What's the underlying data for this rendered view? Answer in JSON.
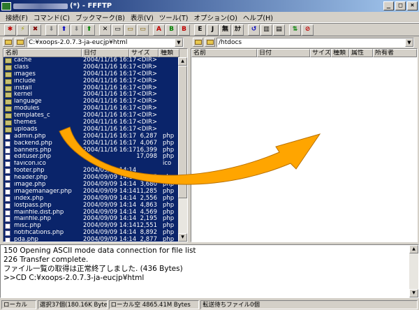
{
  "window": {
    "title": "(*) - FFFTP"
  },
  "menu": [
    "接続(F)",
    "コマンド(C)",
    "ブックマーク(B)",
    "表示(V)",
    "ツール(T)",
    "オプション(O)",
    "ヘルプ(H)"
  ],
  "toolbar": {
    "buttons": [
      {
        "name": "connect-button",
        "glyph": "✱",
        "color": "#c00000"
      },
      {
        "name": "quick-connect-button",
        "glyph": "⚡",
        "color": "#a0a000"
      },
      {
        "name": "disconnect-button",
        "glyph": "✖",
        "color": "#800000"
      },
      {
        "name": "download-button",
        "glyph": "⬇",
        "color": "#808080"
      },
      {
        "name": "upload-button",
        "glyph": "⬆",
        "color": "#0000c0"
      },
      {
        "name": "download-name-button",
        "glyph": "⬇",
        "color": "#808080"
      },
      {
        "name": "upload-name-button",
        "glyph": "⬆",
        "color": "#008000"
      },
      {
        "name": "delete-button",
        "glyph": "✕",
        "color": "#000000"
      },
      {
        "name": "rename-button",
        "glyph": "▭",
        "color": "#000000"
      },
      {
        "name": "mkdir-button",
        "glyph": "▭",
        "color": "#806000"
      },
      {
        "name": "parent-dir-button",
        "glyph": "▭",
        "color": "#806000"
      },
      {
        "name": "transfer-auto-button",
        "glyph": "A",
        "color": "#c00000"
      },
      {
        "name": "transfer-binary-button",
        "glyph": "B",
        "color": "#008000"
      },
      {
        "name": "transfer-ascii-button",
        "glyph": "B",
        "color": "#c00000"
      },
      {
        "name": "kanji-euc-button",
        "glyph": "E",
        "color": "#000000"
      },
      {
        "name": "kanji-jis-button",
        "glyph": "J",
        "color": "#000000"
      },
      {
        "name": "kanji-none-button",
        "glyph": "無",
        "color": "#000000"
      },
      {
        "name": "kana-convert-button",
        "glyph": "ｶﾅ",
        "color": "#000000"
      },
      {
        "name": "refresh-button",
        "glyph": "↺",
        "color": "#0000c0"
      },
      {
        "name": "list-view-button",
        "glyph": "▥",
        "color": "#000000"
      },
      {
        "name": "detail-view-button",
        "glyph": "▤",
        "color": "#000000"
      },
      {
        "name": "sync-button",
        "glyph": "⇅",
        "color": "#008000"
      },
      {
        "name": "abort-button",
        "glyph": "⊘",
        "color": "#c00000"
      }
    ]
  },
  "local": {
    "path": "C:¥xoops-2.0.7.3-ja-eucjp¥html",
    "columns": [
      "名前",
      "日付",
      "サイズ",
      "種類"
    ],
    "files": [
      {
        "name": "cache",
        "date": "2004/11/16 16:17",
        "size": "<DIR>",
        "type": "",
        "dir": true
      },
      {
        "name": "class",
        "date": "2004/11/16 16:17",
        "size": "<DIR>",
        "type": "",
        "dir": true
      },
      {
        "name": "images",
        "date": "2004/11/16 16:17",
        "size": "<DIR>",
        "type": "",
        "dir": true
      },
      {
        "name": "include",
        "date": "2004/11/16 16:17",
        "size": "<DIR>",
        "type": "",
        "dir": true
      },
      {
        "name": "install",
        "date": "2004/11/16 16:17",
        "size": "<DIR>",
        "type": "",
        "dir": true
      },
      {
        "name": "kernel",
        "date": "2004/11/16 16:17",
        "size": "<DIR>",
        "type": "",
        "dir": true
      },
      {
        "name": "language",
        "date": "2004/11/16 16:17",
        "size": "<DIR>",
        "type": "",
        "dir": true
      },
      {
        "name": "modules",
        "date": "2004/11/16 16:17",
        "size": "<DIR>",
        "type": "",
        "dir": true
      },
      {
        "name": "templates_c",
        "date": "2004/11/16 16:17",
        "size": "<DIR>",
        "type": "",
        "dir": true
      },
      {
        "name": "themes",
        "date": "2004/11/16 16:17",
        "size": "<DIR>",
        "type": "",
        "dir": true
      },
      {
        "name": "uploads",
        "date": "2004/11/16 16:17",
        "size": "<DIR>",
        "type": "",
        "dir": true
      },
      {
        "name": "admin.php",
        "date": "2004/11/16 16:17",
        "size": "6,287",
        "type": "php",
        "dir": false
      },
      {
        "name": "backend.php",
        "date": "2004/11/16 16:17",
        "size": "4,067",
        "type": "php",
        "dir": false
      },
      {
        "name": "banners.php",
        "date": "2004/11/16 16:17",
        "size": "16,399",
        "type": "php",
        "dir": false
      },
      {
        "name": "edituser.php",
        "date": "",
        "size": "17,098",
        "type": "php",
        "dir": false
      },
      {
        "name": "favicon.ico",
        "date": "",
        "size": "",
        "type": "ico",
        "dir": false
      },
      {
        "name": "footer.php",
        "date": "2004/09/09 14:14",
        "size": "",
        "type": "",
        "dir": false
      },
      {
        "name": "header.php",
        "date": "2004/09/09 14:14",
        "size": "12,125",
        "type": "php",
        "dir": false
      },
      {
        "name": "image.php",
        "date": "2004/09/09 14:14",
        "size": "3,680",
        "type": "php",
        "dir": false
      },
      {
        "name": "imagemanager.php",
        "date": "2004/09/09 14:14",
        "size": "11,285",
        "type": "php",
        "dir": false
      },
      {
        "name": "index.php",
        "date": "2004/09/09 14:14",
        "size": "2,556",
        "type": "php",
        "dir": false
      },
      {
        "name": "lostpass.php",
        "date": "2004/09/09 14:14",
        "size": "4,863",
        "type": "php",
        "dir": false
      },
      {
        "name": "mainfile.dist.php",
        "date": "2004/09/09 14:14",
        "size": "4,569",
        "type": "php",
        "dir": false
      },
      {
        "name": "mainfile.php",
        "date": "2004/09/09 14:14",
        "size": "2,195",
        "type": "php",
        "dir": false
      },
      {
        "name": "misc.php",
        "date": "2004/09/09 14:14",
        "size": "12,551",
        "type": "php",
        "dir": false
      },
      {
        "name": "notifications.php",
        "date": "2004/09/09 14:14",
        "size": "8,892",
        "type": "php",
        "dir": false
      },
      {
        "name": "pda.php",
        "date": "2004/09/09 14:14",
        "size": "2,877",
        "type": "php",
        "dir": false
      }
    ]
  },
  "remote": {
    "path": "/htdocs",
    "columns": [
      "名前",
      "日付",
      "サイズ",
      "種類",
      "属性",
      "所有者"
    ]
  },
  "log": {
    "lines": [
      "150 Opening ASCII mode data connection for file list",
      "226 Transfer complete.",
      "ファイル一覧の取得は正常終了しました. (436 Bytes)",
      ">>CD C:¥xoops-2.0.7.3-ja-eucjp¥html"
    ]
  },
  "status": {
    "mode": "ローカル",
    "selection": "選択37個(180.16K Bytes)",
    "free": "ローカル空 4865.41M Bytes",
    "queue": "転送待ちファイル0個"
  },
  "colors": {
    "selection": "#0a246a",
    "arrow": "#ffa500"
  }
}
